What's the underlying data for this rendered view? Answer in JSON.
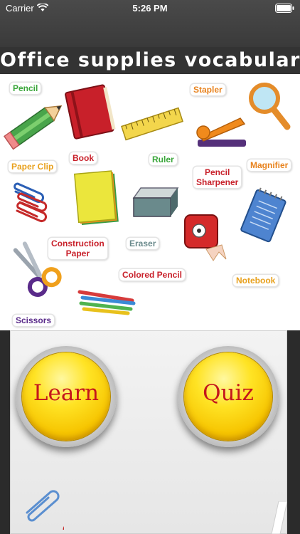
{
  "status_bar": {
    "carrier": "Carrier",
    "time": "5:26 PM"
  },
  "title": "Office supplies vocabulary",
  "poster_labels": {
    "pencil": "Pencil",
    "book": "Book",
    "ruler": "Ruler",
    "stapler": "Stapler",
    "magnifier": "Magnifier",
    "paper_clip": "Paper Clip",
    "pencil_sharpener_1": "Pencil",
    "pencil_sharpener_2": "Sharpener",
    "construction_paper_1": "Construction",
    "construction_paper_2": "Paper",
    "eraser": "Eraser",
    "colored_pencil": "Colored Pencil",
    "notebook": "Notebook",
    "scissors": "Scissors"
  },
  "buttons": {
    "learn": "Learn",
    "quiz": "Quiz"
  },
  "colors": {
    "title_bar": "#333333",
    "button_text": "#c4161c",
    "button_face": "#ffe324"
  }
}
